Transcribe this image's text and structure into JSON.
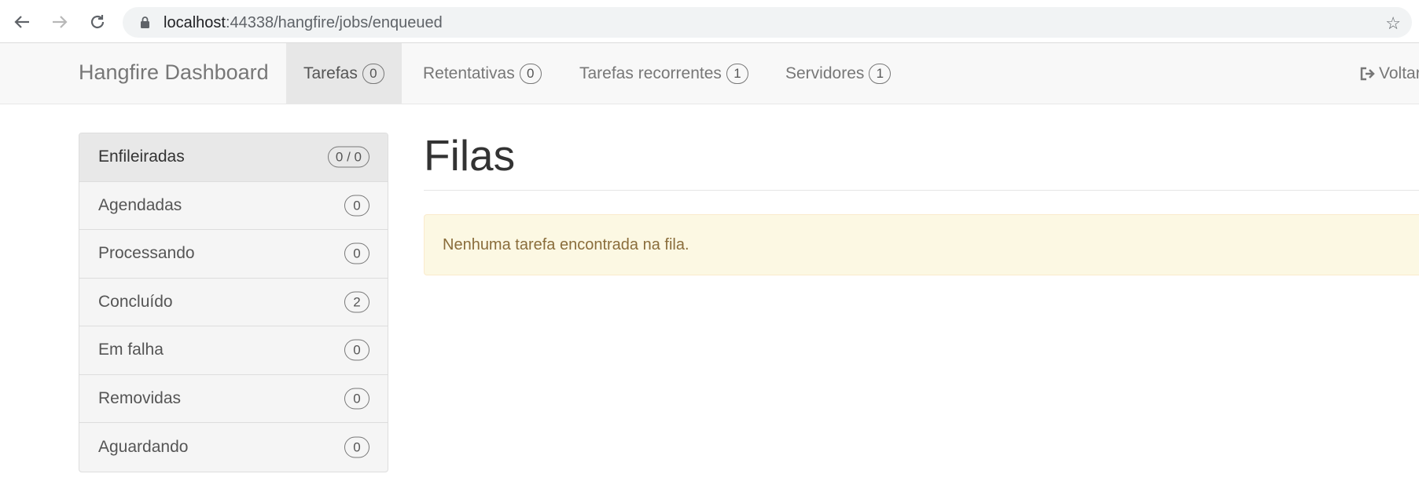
{
  "browser": {
    "url_host": "localhost",
    "url_rest": ":44338/hangfire/jobs/enqueued"
  },
  "navbar": {
    "brand": "Hangfire Dashboard",
    "items": [
      {
        "label": "Tarefas",
        "count": "0"
      },
      {
        "label": "Retentativas",
        "count": "0"
      },
      {
        "label": "Tarefas recorrentes",
        "count": "1"
      },
      {
        "label": "Servidores",
        "count": "1"
      }
    ],
    "logout_label": "Voltar"
  },
  "sidebar": {
    "items": [
      {
        "label": "Enfileiradas",
        "count": "0 / 0"
      },
      {
        "label": "Agendadas",
        "count": "0"
      },
      {
        "label": "Processando",
        "count": "0"
      },
      {
        "label": "Concluído",
        "count": "2"
      },
      {
        "label": "Em falha",
        "count": "0"
      },
      {
        "label": "Removidas",
        "count": "0"
      },
      {
        "label": "Aguardando",
        "count": "0"
      }
    ]
  },
  "main": {
    "title": "Filas",
    "alert": "Nenhuma tarefa encontrada na fila."
  }
}
